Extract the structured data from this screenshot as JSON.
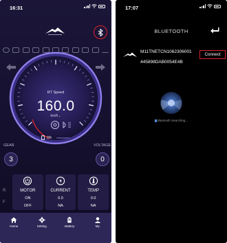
{
  "left_screen": {
    "status": {
      "time": "16:31"
    },
    "speedometer": {
      "label": "RT Speed",
      "value": "160.0",
      "unit": "km/h",
      "battery_text": "0%",
      "battery_fraction": 0.0
    },
    "gear": {
      "label": "GEAR",
      "value": "3"
    },
    "voltage": {
      "label": "VOLTAGE",
      "value": "0"
    },
    "side_letters": [
      "R",
      "F"
    ],
    "cards": [
      {
        "title": "MOTOR",
        "value1": "ON",
        "value2": "OFF",
        "icon": "power-icon"
      },
      {
        "title": "CURRENT",
        "value1": "0.0",
        "value2": "NA",
        "icon": "current-icon"
      },
      {
        "title": "TEMP",
        "value1": "0.0",
        "value2": "NA",
        "icon": "thermometer-icon"
      }
    ],
    "tabs": [
      {
        "label": "Home",
        "icon": "home-icon"
      },
      {
        "label": "Setting",
        "icon": "gear-icon"
      },
      {
        "label": "Battery",
        "icon": "battery-icon"
      },
      {
        "label": "My",
        "icon": "person-icon"
      }
    ],
    "colors": {
      "accent": "#7b6bff",
      "bluetooth_ring": "#e0232e",
      "tabbar": "#2d2758"
    }
  },
  "right_screen": {
    "status": {
      "time": "17:07"
    },
    "title": "BLUETOOTH",
    "device": {
      "name": "M11TNETCN1062306001",
      "mac": "445898DAB0054E4B",
      "connect_label": "Connect"
    },
    "searching_text": "Bluetooth Searching...",
    "colors": {
      "background": "#000000",
      "connect_border": "#e0232e"
    }
  }
}
